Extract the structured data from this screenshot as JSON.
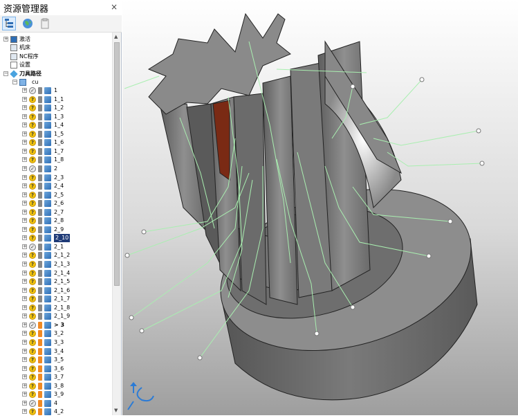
{
  "explorer": {
    "title": "资源管理器",
    "close": "×"
  },
  "icons": {
    "toolbar": [
      "tree-view-icon",
      "globe-icon",
      "clipboard-icon"
    ]
  },
  "colors": {
    "accent": "#1f3b77",
    "toolpath": "#a9efb0",
    "part": "#6e6e6e"
  },
  "tree": {
    "top": [
      {
        "label": "激活",
        "name": "tree-item-activate"
      },
      {
        "label": "机床",
        "name": "tree-item-machine"
      },
      {
        "label": "NC程序",
        "name": "tree-item-nc-program"
      },
      {
        "label": "设置",
        "name": "tree-item-settings"
      }
    ],
    "toolpaths_label": "刀具路径",
    "folder_label": "cu",
    "items": [
      {
        "label": "1",
        "status": "check"
      },
      {
        "label": "1_1",
        "status": "question"
      },
      {
        "label": "1_2",
        "status": "question"
      },
      {
        "label": "1_3",
        "status": "question"
      },
      {
        "label": "1_4",
        "status": "question"
      },
      {
        "label": "1_5",
        "status": "question"
      },
      {
        "label": "1_6",
        "status": "question"
      },
      {
        "label": "1_7",
        "status": "question"
      },
      {
        "label": "1_8",
        "status": "question"
      },
      {
        "label": "2",
        "status": "check"
      },
      {
        "label": "2_3",
        "status": "question"
      },
      {
        "label": "2_4",
        "status": "question"
      },
      {
        "label": "2_5",
        "status": "question"
      },
      {
        "label": "2_6",
        "status": "question"
      },
      {
        "label": "2_7",
        "status": "question"
      },
      {
        "label": "2_8",
        "status": "question"
      },
      {
        "label": "2_9",
        "status": "question"
      },
      {
        "label": "2_10",
        "status": "question",
        "selected": true
      },
      {
        "label": "2_1",
        "status": "check"
      },
      {
        "label": "2_1_2",
        "status": "question"
      },
      {
        "label": "2_1_3",
        "status": "question"
      },
      {
        "label": "2_1_4",
        "status": "question"
      },
      {
        "label": "2_1_5",
        "status": "question"
      },
      {
        "label": "2_1_6",
        "status": "question"
      },
      {
        "label": "2_1_7",
        "status": "question"
      },
      {
        "label": "2_1_8",
        "status": "question"
      },
      {
        "label": "2_1_9",
        "status": "question"
      },
      {
        "label": "> 3",
        "status": "check",
        "active": true
      },
      {
        "label": "3_2",
        "status": "question"
      },
      {
        "label": "3_3",
        "status": "question"
      },
      {
        "label": "3_4",
        "status": "question"
      },
      {
        "label": "3_5",
        "status": "question"
      },
      {
        "label": "3_6",
        "status": "question"
      },
      {
        "label": "3_7",
        "status": "question"
      },
      {
        "label": "3_8",
        "status": "question"
      },
      {
        "label": "3_9",
        "status": "question"
      },
      {
        "label": "4",
        "status": "check"
      },
      {
        "label": "4_2",
        "status": "question"
      }
    ]
  }
}
